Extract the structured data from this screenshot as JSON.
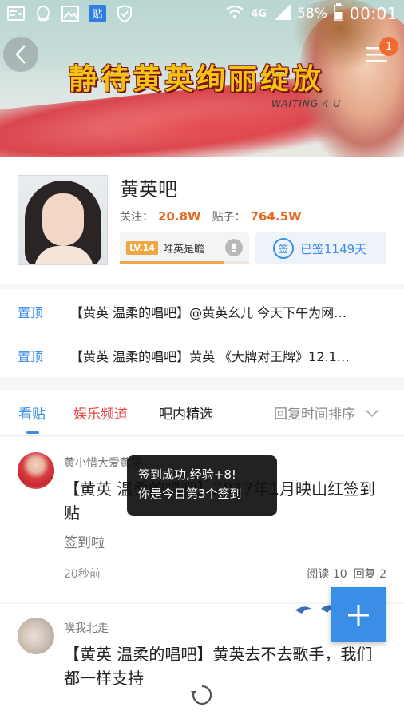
{
  "status_bar": {
    "network": "4G",
    "battery": "58%",
    "time": "00:01",
    "left_icons": [
      "news-icon",
      "qq-icon",
      "image-icon",
      "tieba-icon",
      "shield-icon"
    ]
  },
  "banner": {
    "title": "静待黄英绚丽绽放",
    "subtitle": "WAITING 4 U",
    "menu_badge": "1"
  },
  "forum": {
    "name": "黄英吧",
    "follow_label": "关注：",
    "follow_count": "20.8W",
    "posts_label": "贴子：",
    "posts_count": "764.5W",
    "level_badge": "LV.14",
    "level_title": "唯英是瞻",
    "level_progress": 0.8,
    "sign_icon_text": "签",
    "sign_label": "已签1149天"
  },
  "pinned": [
    {
      "tag": "置顶",
      "title": "【黄英 温柔的唱吧】@黄英幺儿 今天下午为网…"
    },
    {
      "tag": "置顶",
      "title": "【黄英 温柔的唱吧】黄英 《大牌对王牌》12.1…"
    }
  ],
  "tabs": {
    "items": [
      "看贴",
      "娱乐频道",
      "吧内精选"
    ],
    "sort": "回复时间排序",
    "colors": {
      "active": "#3b8ee5",
      "highlight": "#e94040"
    }
  },
  "posts": [
    {
      "author": "黄小惜大爱黄英",
      "title": "【黄英 温柔的唱吧】2017年1月映山红签到贴",
      "subtitle": "签到啦",
      "time": "20秒前",
      "reads": "阅读 10",
      "replies": "回复 2"
    },
    {
      "author": "唉我北走",
      "title": "【黄英 温柔的唱吧】黄英去不去歌手，我们都一样支持"
    }
  ],
  "toast": {
    "line1": "签到成功,经验+8!",
    "line2": "你是今日第3个签到"
  }
}
